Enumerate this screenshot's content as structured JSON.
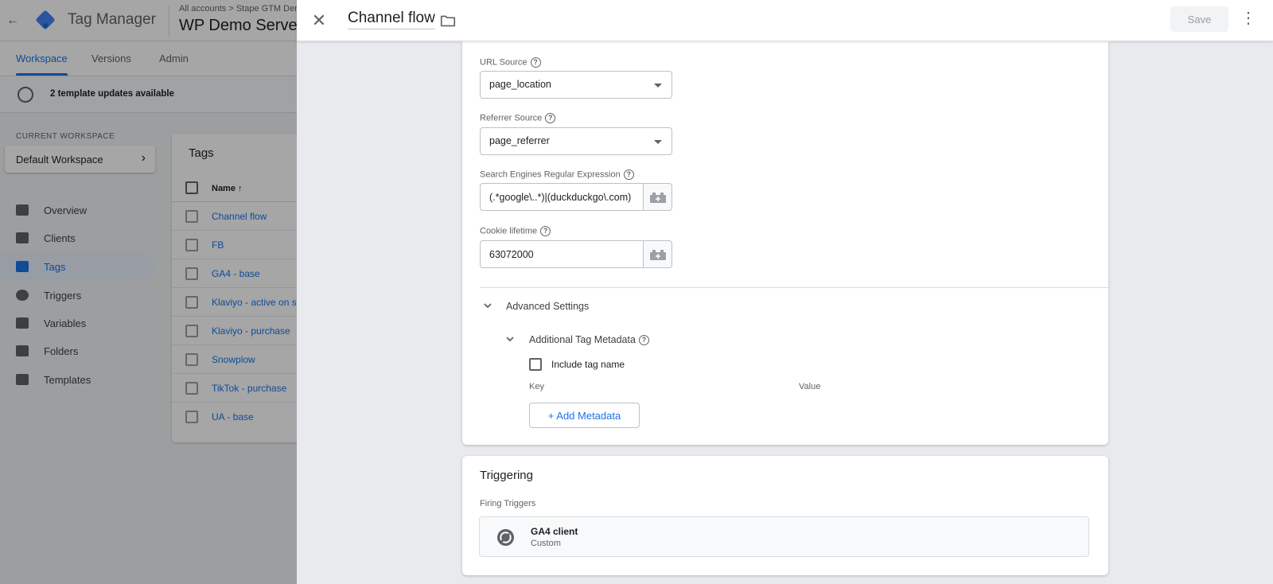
{
  "background": {
    "app_name": "Tag Manager",
    "breadcrumb": "All accounts > Stape GTM Dem",
    "container_name": "WP Demo Server",
    "tabs": [
      {
        "label": "Workspace"
      },
      {
        "label": "Versions"
      },
      {
        "label": "Admin"
      }
    ],
    "updates_text": "2 template updates available",
    "workspace_label": "CURRENT WORKSPACE",
    "workspace_name": "Default Workspace",
    "nav": [
      {
        "label": "Overview",
        "icon": "overview-icon"
      },
      {
        "label": "Clients",
        "icon": "clients-icon"
      },
      {
        "label": "Tags",
        "icon": "tag-icon"
      },
      {
        "label": "Triggers",
        "icon": "trigger-icon"
      },
      {
        "label": "Variables",
        "icon": "variables-icon"
      },
      {
        "label": "Folders",
        "icon": "folder-icon"
      },
      {
        "label": "Templates",
        "icon": "templates-icon"
      }
    ],
    "tags_title": "Tags",
    "tags_column": "Name ↑",
    "tags": [
      {
        "name": "Channel flow"
      },
      {
        "name": "FB"
      },
      {
        "name": "GA4 - base"
      },
      {
        "name": "Klaviyo - active on si"
      },
      {
        "name": "Klaviyo - purchase"
      },
      {
        "name": "Snowplow"
      },
      {
        "name": "TikTok - purchase"
      },
      {
        "name": "UA - base"
      }
    ]
  },
  "panel": {
    "title": "Channel flow",
    "save_label": "Save",
    "more_icon": "⋮",
    "close_icon": "✕"
  },
  "config": {
    "url_source": {
      "label": "URL Source",
      "value": "page_location"
    },
    "referrer_source": {
      "label": "Referrer Source",
      "value": "page_referrer"
    },
    "search_engines": {
      "label": "Search Engines Regular Expression",
      "value": "(.*google\\..*)|(duckduckgo\\.com)"
    },
    "cookie_lifetime": {
      "label": "Cookie lifetime",
      "value": "63072000"
    },
    "advanced_label": "Advanced Settings",
    "metadata_label": "Additional Tag Metadata",
    "include_tag_name": "Include tag name",
    "key_header": "Key",
    "value_header": "Value",
    "add_metadata": "+ Add Metadata"
  },
  "triggering": {
    "title": "Triggering",
    "subtitle": "Firing Triggers",
    "trigger_name": "GA4 client",
    "trigger_type": "Custom"
  },
  "colors": {
    "accent": "#1a73e8",
    "text": "#202124",
    "muted": "#5f6368"
  }
}
